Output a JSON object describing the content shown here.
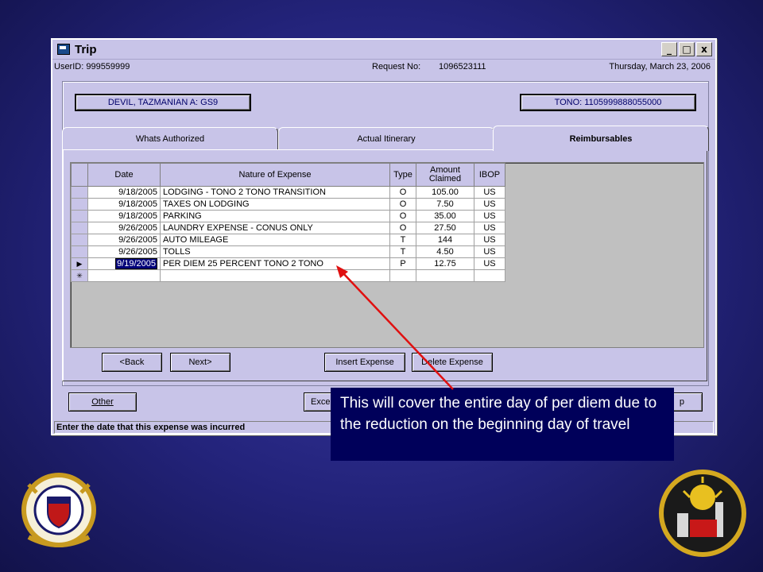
{
  "window": {
    "title": "Trip",
    "controls": {
      "minimize": "_",
      "maximize": "□",
      "close": "x"
    }
  },
  "infobar": {
    "user_id": "UserID: 999559999",
    "request_label": "Request No:",
    "request_no": "1096523111",
    "date": "Thursday, March 23, 2006"
  },
  "header": {
    "traveler": "DEVIL, TAZMANIAN A: GS9",
    "tono": "TONO: 1105999888055000"
  },
  "tabs": [
    {
      "label": "Whats Authorized"
    },
    {
      "label": "Actual Itinerary"
    },
    {
      "label": "Reimbursables"
    }
  ],
  "grid": {
    "headers": {
      "date": "Date",
      "nature": "Nature of Expense",
      "type": "Type",
      "amount": "Amount Claimed",
      "ibop": "IBOP"
    },
    "rows": [
      {
        "date": "9/18/2005",
        "nature": "LODGING - TONO 2 TONO TRANSITION",
        "type": "O",
        "amount": "105.00",
        "ibop": "US"
      },
      {
        "date": "9/18/2005",
        "nature": "TAXES ON LODGING",
        "type": "O",
        "amount": "7.50",
        "ibop": "US"
      },
      {
        "date": "9/18/2005",
        "nature": "PARKING",
        "type": "O",
        "amount": "35.00",
        "ibop": "US"
      },
      {
        "date": "9/26/2005",
        "nature": "LAUNDRY EXPENSE  - CONUS ONLY",
        "type": "O",
        "amount": "27.50",
        "ibop": "US"
      },
      {
        "date": "9/26/2005",
        "nature": "AUTO MILEAGE",
        "type": "T",
        "amount": "144",
        "ibop": "US"
      },
      {
        "date": "9/26/2005",
        "nature": "TOLLS",
        "type": "T",
        "amount": "4.50",
        "ibop": "US"
      },
      {
        "date": "9/19/2005",
        "nature": "PER DIEM 25 PERCENT TONO 2 TONO",
        "type": "P",
        "amount": "12.75",
        "ibop": "US"
      }
    ],
    "current_marker": "▶",
    "new_marker": "✳"
  },
  "buttons": {
    "back": "<Back",
    "next": "Next>",
    "insert": "Insert Expense",
    "delete": "Delete Expense",
    "other": "Other",
    "exce": "Exce",
    "help_tail": "p"
  },
  "status": "Enter the date that this expense was incurred",
  "callout": "This will cover the entire day of per diem due to the reduction on the beginning day of travel",
  "colors": {
    "background": "#23237a",
    "window": "#c8c4e8",
    "arrow": "#e01010",
    "callout": "#00005a"
  }
}
